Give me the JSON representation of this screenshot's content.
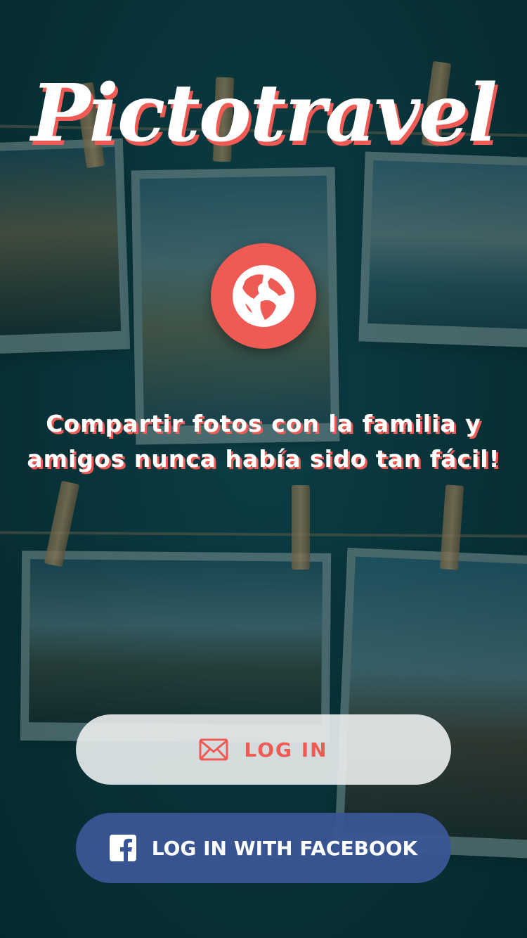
{
  "app": {
    "title": "Pictotravel",
    "tagline_line1": "Compartir fotos con la familia y",
    "tagline_line2": "amigos nunca había sido tan fácil!"
  },
  "buttons": {
    "login_label": "LOG IN",
    "facebook_label": "LOG IN WITH FACEBOOK"
  },
  "icons": {
    "logo_badge": "globe-icon",
    "login": "envelope-icon",
    "facebook": "facebook-icon"
  },
  "colors": {
    "accent": "#ef5a55",
    "background": "#0b3a40",
    "facebook": "#3a5696",
    "login_button_bg": "#ebeeee"
  }
}
